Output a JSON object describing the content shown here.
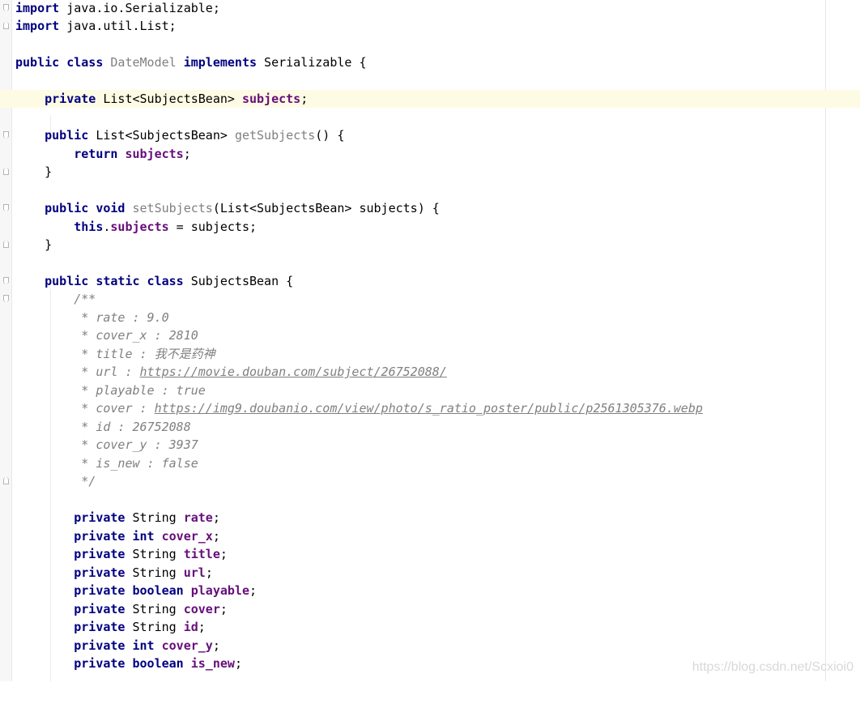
{
  "colors": {
    "keyword": "#000080",
    "field": "#660e7a",
    "declaration": "#808080",
    "comment": "#808080",
    "caret_line": "#fefbe4",
    "gutter": "#f7f7f7"
  },
  "code": {
    "l1": {
      "kw": "import",
      "text": " java.io.Serializable;"
    },
    "l2": {
      "kw": "import",
      "text": " java.util.List;"
    },
    "l4": {
      "kw1": "public class",
      "name": "DateModel",
      "kw2": "implements",
      "text": " Serializable {"
    },
    "l6": {
      "kw": "private",
      "type": " List<SubjectsBean> ",
      "field": "subjects",
      "end": ";"
    },
    "l8": {
      "kw": "public",
      "type": " List<SubjectsBean> ",
      "method": "getSubjects",
      "end": "() {"
    },
    "l9": {
      "kw": "return",
      "field": "subjects",
      "end": ";"
    },
    "l10": {
      "text": "}"
    },
    "l12": {
      "kw": "public void",
      "method": "setSubjects",
      "end": "(List<SubjectsBean> subjects) {"
    },
    "l13": {
      "kw": "this",
      "dot": ".",
      "field": "subjects",
      "end": " = subjects;"
    },
    "l14": {
      "text": "}"
    },
    "l16": {
      "kw": "public static class",
      "text": " SubjectsBean {"
    },
    "comment": {
      "open": "/**",
      "rate": " * rate : 9.0",
      "cover_x": " * cover_x : 2810",
      "title": " * title : 我不是药神",
      "url_prefix": " * url : ",
      "url": "https://movie.douban.com/subject/26752088/",
      "playable": " * playable : true",
      "cover_prefix": " * cover : ",
      "cover": "https://img9.doubanio.com/view/photo/s_ratio_poster/public/p2561305376.webp",
      "id": " * id : 26752088",
      "cover_y": " * cover_y : 3937",
      "is_new": " * is_new : false",
      "close": " */"
    },
    "fields": [
      {
        "kw": "private",
        "type": " String ",
        "name": "rate"
      },
      {
        "kw": "private int",
        "type": " ",
        "name": "cover_x"
      },
      {
        "kw": "private",
        "type": " String ",
        "name": "title"
      },
      {
        "kw": "private",
        "type": " String ",
        "name": "url"
      },
      {
        "kw": "private boolean",
        "type": " ",
        "name": "playable"
      },
      {
        "kw": "private",
        "type": " String ",
        "name": "cover"
      },
      {
        "kw": "private",
        "type": " String ",
        "name": "id"
      },
      {
        "kw": "private int",
        "type": " ",
        "name": "cover_y"
      },
      {
        "kw": "private boolean",
        "type": " ",
        "name": "is_new"
      }
    ],
    "semicolon": ";"
  },
  "watermark": "https://blog.csdn.net/Scxioi0"
}
